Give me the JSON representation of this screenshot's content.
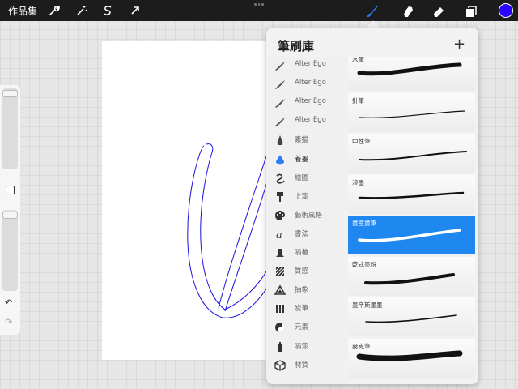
{
  "topbar": {
    "gallery_label": "作品集",
    "tools": [
      {
        "icon": "wrench-icon"
      },
      {
        "icon": "magic-wand-icon"
      },
      {
        "icon": "selection-s-icon"
      },
      {
        "icon": "transform-arrow-icon"
      }
    ],
    "right_tools": [
      "brush-icon",
      "smudge-icon",
      "eraser-icon",
      "layers-icon"
    ],
    "active_tool": "brush-icon",
    "accent_color": "#2a7cf6",
    "current_color": "#2a00ff"
  },
  "sidebar": {
    "undo_glyph": "↶",
    "redo_glyph": "↷"
  },
  "brush_library": {
    "title": "筆刷庫",
    "add_glyph": "+",
    "categories": [
      {
        "label": "Alter Ego",
        "icon": "stroke-icon"
      },
      {
        "label": "Alter Ego",
        "icon": "stroke-icon"
      },
      {
        "label": "Alter Ego",
        "icon": "stroke-icon"
      },
      {
        "label": "Alter Ego",
        "icon": "stroke-icon"
      },
      {
        "label": "素描",
        "icon": "pencil-tip-icon"
      },
      {
        "label": "着墨",
        "icon": "ink-drop-icon"
      },
      {
        "label": "繪圖",
        "icon": "swirl-icon"
      },
      {
        "label": "上漆",
        "icon": "paint-roller-icon"
      },
      {
        "label": "藝術風格",
        "icon": "palette-icon"
      },
      {
        "label": "書法",
        "icon": "calligraphy-icon"
      },
      {
        "label": "噴槍",
        "icon": "airbrush-icon"
      },
      {
        "label": "質感",
        "icon": "texture-icon"
      },
      {
        "label": "抽象",
        "icon": "triangle-icon"
      },
      {
        "label": "炭筆",
        "icon": "charcoal-icon"
      },
      {
        "label": "元素",
        "icon": "yin-yang-icon"
      },
      {
        "label": "噴漆",
        "icon": "spray-can-icon"
      },
      {
        "label": "材質",
        "icon": "cube-icon"
      }
    ],
    "active_category": 5,
    "brushes": [
      {
        "name": "水筆",
        "selected": false
      },
      {
        "name": "針筆",
        "selected": false
      },
      {
        "name": "中性筆",
        "selected": false
      },
      {
        "name": "滲墨",
        "selected": false
      },
      {
        "name": "畫室畫筆",
        "selected": true
      },
      {
        "name": "乾式墨粉",
        "selected": false
      },
      {
        "name": "墨辛斯墨墨",
        "selected": false
      },
      {
        "name": "麥克筆",
        "selected": false
      }
    ]
  }
}
